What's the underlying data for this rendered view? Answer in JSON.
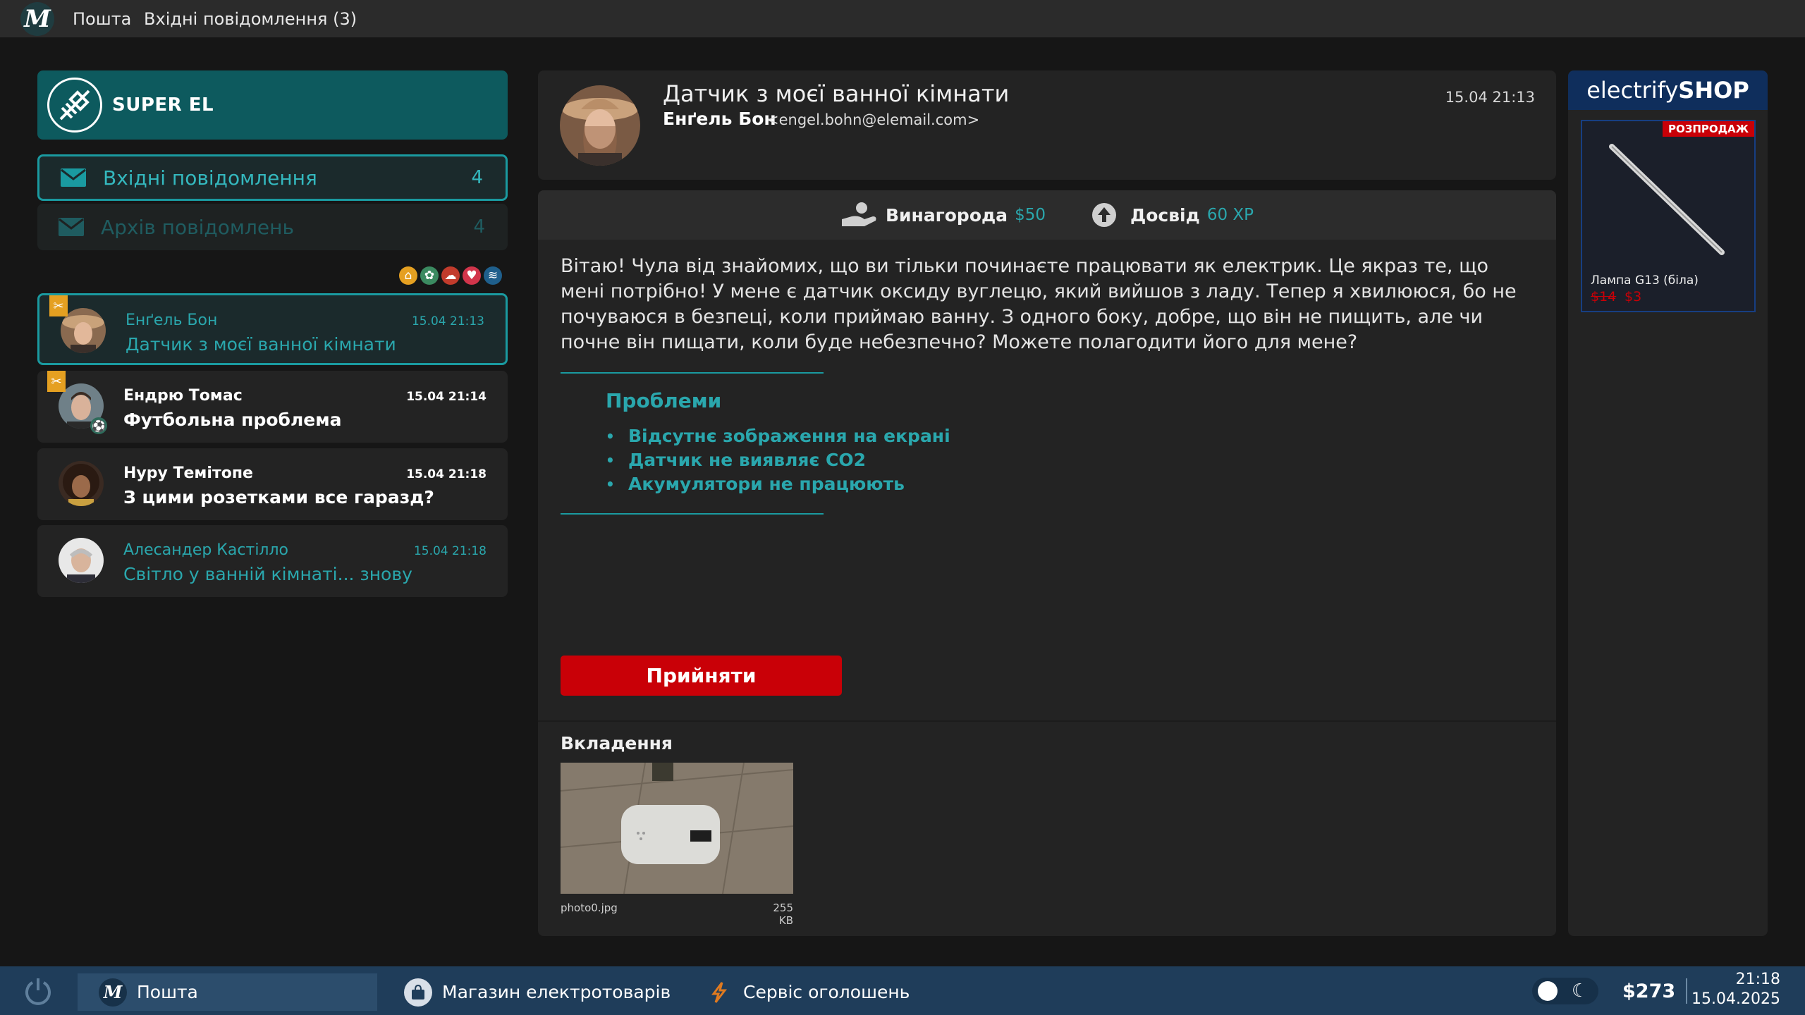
{
  "topbar": {
    "logo_letter": "M",
    "app_name": "Пошта",
    "folder_title": "Вхідні повідомлення (3)"
  },
  "brand": {
    "name": "SUPER EL"
  },
  "folders": [
    {
      "label": "Вхідні повідомлення",
      "count": "4",
      "icon": "envelope-icon"
    },
    {
      "label": "Архів повідомлень",
      "count": "4",
      "icon": "envelope-icon"
    }
  ],
  "status_icons": [
    "house-icon",
    "film-icon",
    "shoe-icon",
    "heart-icon",
    "wifi-icon"
  ],
  "messages": [
    {
      "from": "Енґель Бон",
      "subject": "Датчик з моєї ванної кімнати",
      "date": "15.04 21:13",
      "read": true,
      "badge": "tools-icon"
    },
    {
      "from": "Ендрю Томас",
      "subject": "Футбольна проблема",
      "date": "15.04 21:14",
      "read": false,
      "badge": "tools-icon"
    },
    {
      "from": "Нуру Темітопе",
      "subject": "З цими розетками все гаразд?",
      "date": "15.04 21:18",
      "read": false
    },
    {
      "from": "Алесандер Кастілло",
      "subject": "Світло у ванній кімнаті... знову",
      "date": "15.04 21:18",
      "read": true
    }
  ],
  "email": {
    "subject": "Датчик з моєї ванної кімнати",
    "sender_name": "Енґель Бон",
    "sender_email": "<engel.bohn@elemail.com>",
    "date": "15.04 21:13",
    "reward_label": "Винагорода",
    "reward_value": "$50",
    "xp_label": "Досвід",
    "xp_value": "60 XP",
    "body": "Вітаю! Чула від знайомих, що ви тільки починаєте працювати як електрик. Це якраз те, що мені потрібно! У мене є датчик оксиду вуглецю, який вийшов з ладу. Тепер я хвилююся, бо не почуваюся в безпеці, коли приймаю ванну. З одного боку, добре, що він не пищить, але чи почне він пищати, коли буде небезпечно? Можете полагодити його для мене?",
    "problems_title": "Проблеми",
    "problems": [
      "Відсутнє зображення на екрані",
      "Датчик не виявляє CO2",
      "Акумулятори не працюють"
    ],
    "accept_label": "Прийняти",
    "attachments_title": "Вкладення",
    "attachment": {
      "name": "photo0.jpg",
      "size": "255 KB"
    }
  },
  "shop": {
    "brand_light": "electrify",
    "brand_bold": "SHOP",
    "sale_badge": "РОЗПРОДАЖ",
    "product_name": "Лампа G13 (біла)",
    "price_old": "$14",
    "price_new": "$3"
  },
  "taskbar": {
    "apps": [
      {
        "label": "Пошта",
        "icon": "mail-app-icon",
        "active": true
      },
      {
        "label": "Магазин електротоварів",
        "icon": "shop-bag-icon",
        "active": false
      },
      {
        "label": "Сервіс оголошень",
        "icon": "lightning-icon",
        "active": false
      }
    ],
    "money": "$273",
    "time": "21:18",
    "date": "15.04.2025"
  },
  "colors": {
    "accent": "#1a9aa0",
    "accent_text": "#2aa7ad",
    "brand_bg": "#0d5a5e",
    "accept": "#c90007",
    "shop_header": "#0f2e5c",
    "taskbar": "#1f3d5a"
  }
}
